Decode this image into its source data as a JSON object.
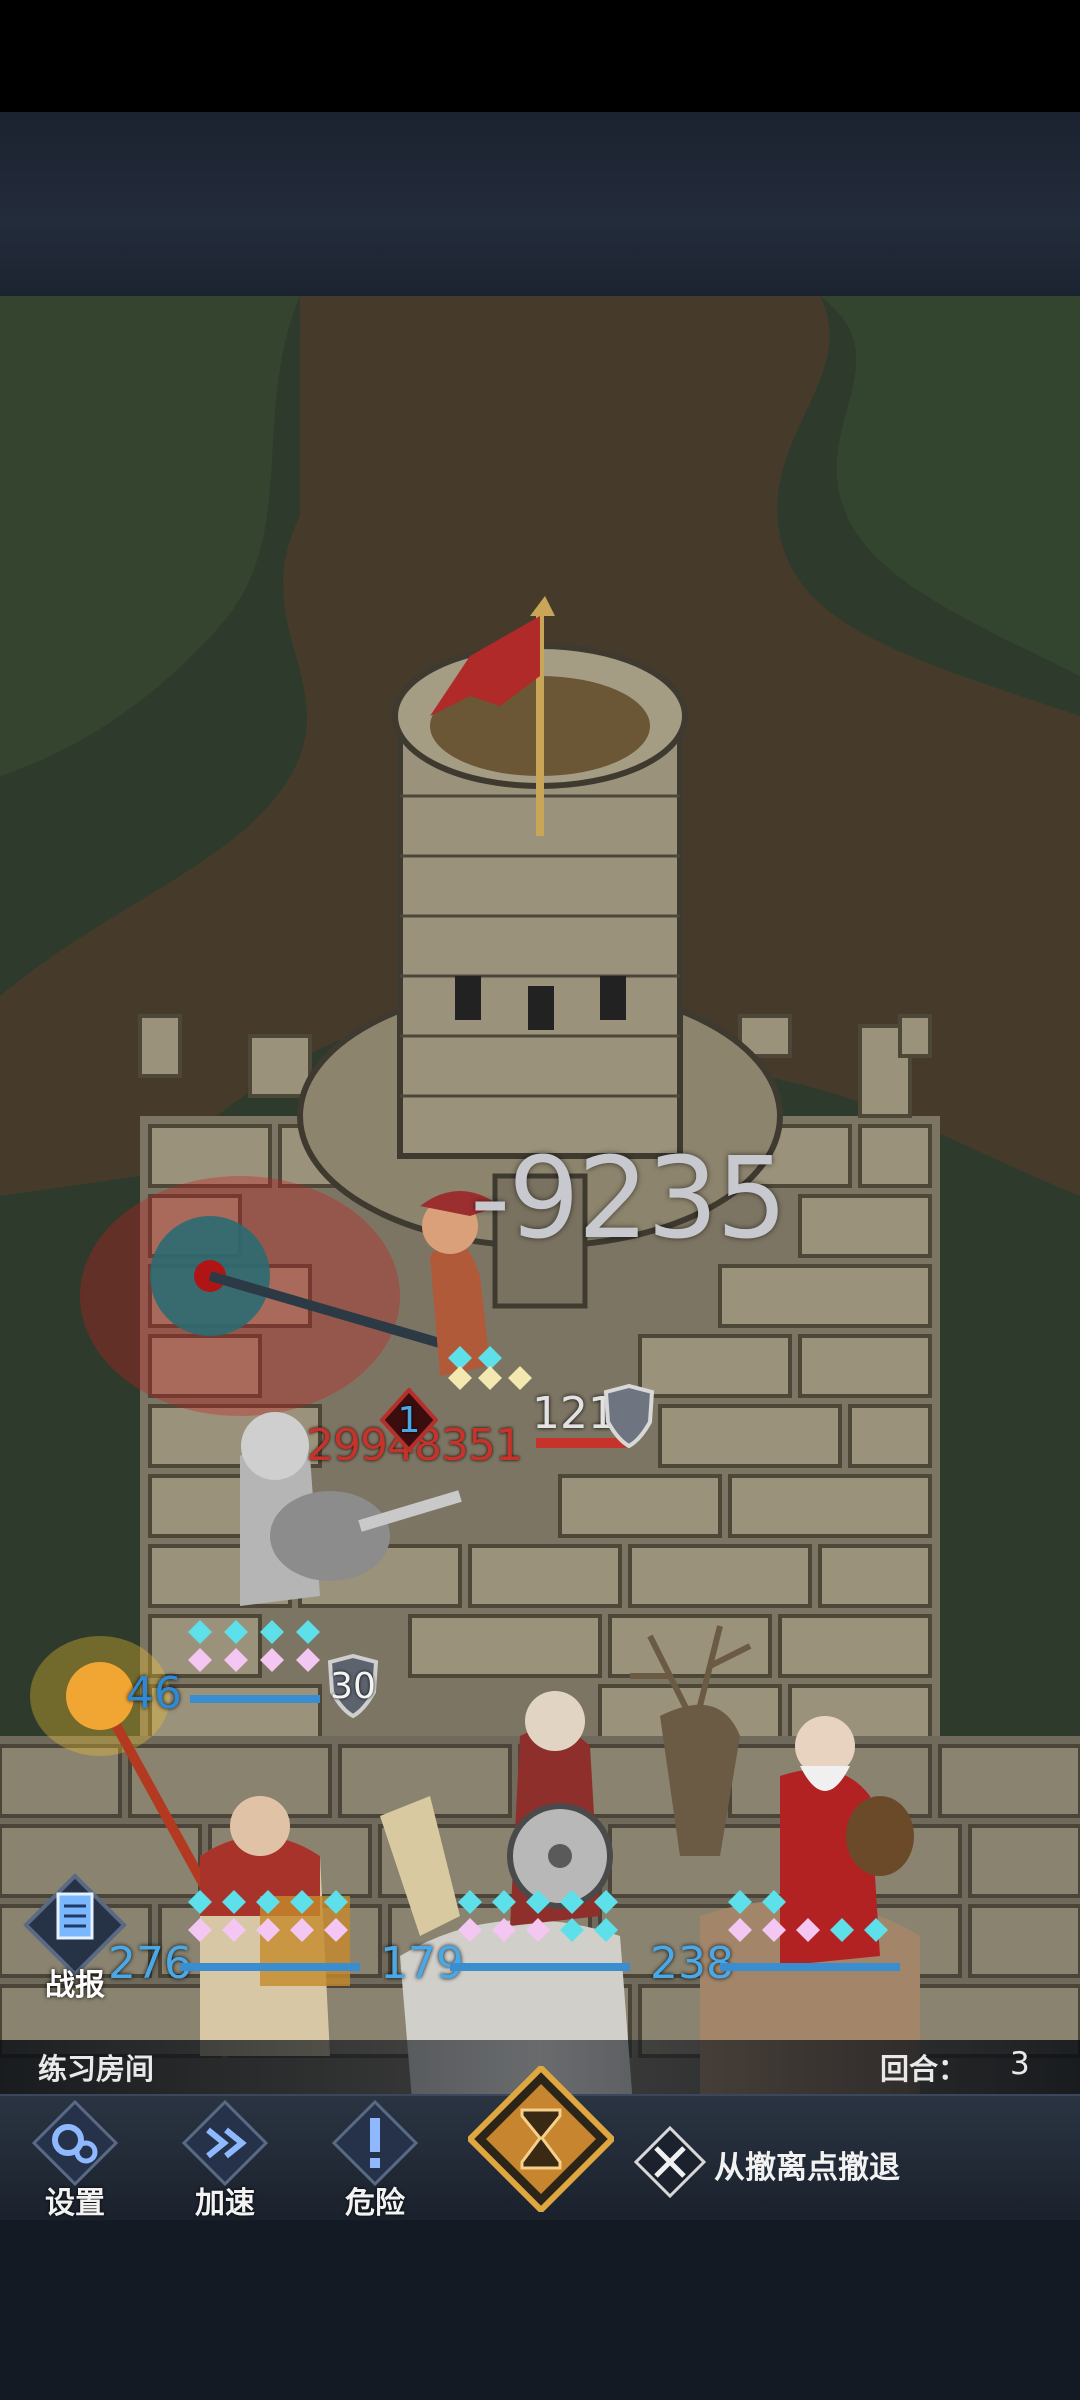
{
  "battle": {
    "damage_popup": "-9235",
    "tower_hp": "29948351",
    "enemy_stat_left": "1",
    "enemy_stat_right": "1211",
    "skeleton_stat_left": "46",
    "skeleton_stat_right": "30",
    "mage_stat": "276",
    "knight_stat": "179",
    "santa_stat": "238"
  },
  "report_button": {
    "label": "战报",
    "icon": "document-icon"
  },
  "info_bar": {
    "room_name": "练习房间",
    "round_label": "回合：",
    "round_value": "3"
  },
  "toolbar": {
    "settings_label": "设置",
    "settings_icon": "gears-icon",
    "speed_label": "加速",
    "speed_icon": "fast-forward-icon",
    "danger_label": "危险",
    "danger_icon": "exclamation-icon",
    "end_turn_icon": "hourglass-icon",
    "retreat_label": "从撤离点撤退",
    "retreat_icon": "crossed-swords-icon"
  },
  "colors": {
    "damage_text": "#c7c9cf",
    "hp_text": "#c6332a",
    "stat_blue": "#4aa8e6",
    "end_turn_gold": "#e0a640"
  }
}
